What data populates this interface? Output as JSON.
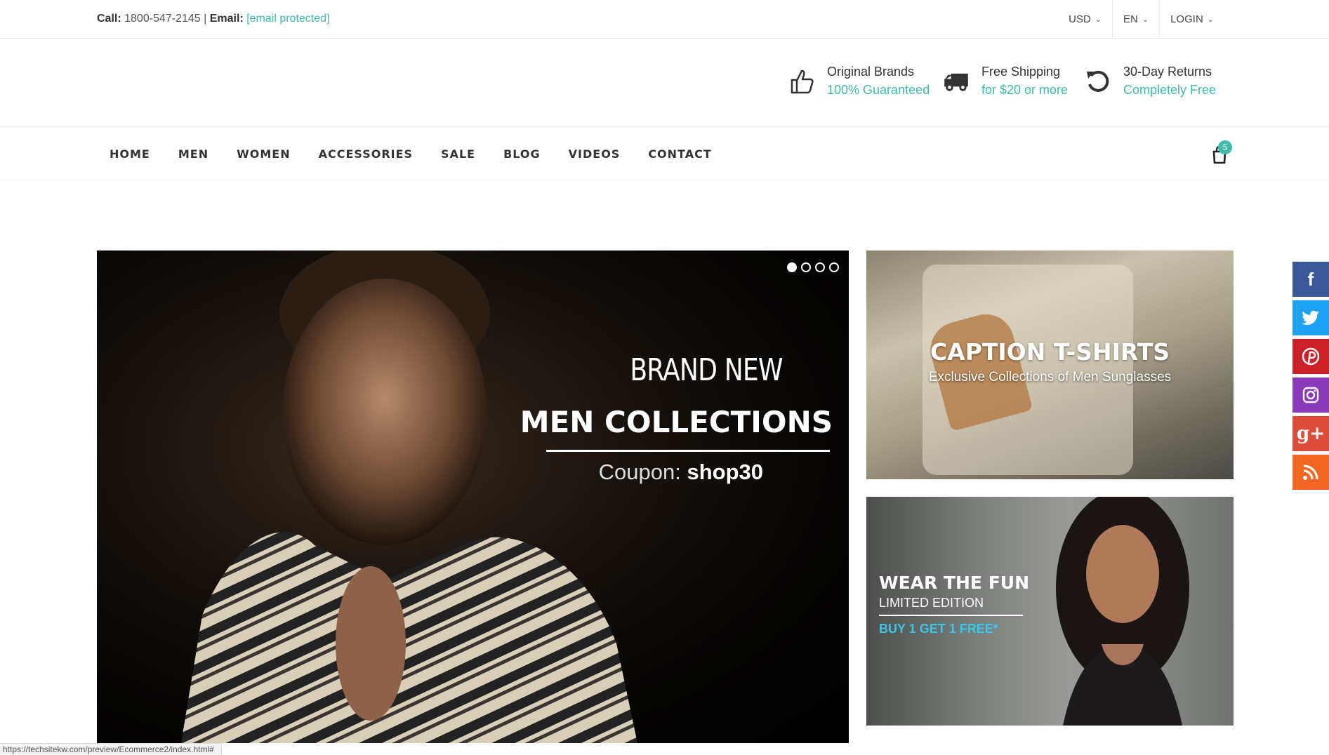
{
  "topbar": {
    "call_label": "Call:",
    "phone": "1800-547-2145",
    "separator": "|",
    "email_label": "Email:",
    "email": "[email protected]",
    "currency": "USD",
    "language": "EN",
    "login": "LOGIN"
  },
  "promos": [
    {
      "icon": "thumbs-up-icon",
      "title": "Original Brands",
      "subtitle": "100% Guaranteed"
    },
    {
      "icon": "truck-icon",
      "title": "Free Shipping",
      "subtitle": "for $20 or more"
    },
    {
      "icon": "refresh-icon",
      "title": "30-Day Returns",
      "subtitle": "Completely Free"
    }
  ],
  "nav": {
    "items": [
      "HOME",
      "MEN",
      "WOMEN",
      "ACCESSORIES",
      "SALE",
      "BLOG",
      "VIDEOS",
      "CONTACT"
    ],
    "cart_count": "5"
  },
  "hero": {
    "line1": "BRAND NEW",
    "line2": "MEN COLLECTIONS",
    "coupon_label": "Coupon:",
    "coupon_code": "shop30",
    "active_slide": 1,
    "slide_count": 4
  },
  "banners": {
    "tshirts": {
      "title": "CAPTION T-SHIRTS",
      "subtitle": "Exclusive Collections of Men Sunglasses"
    },
    "fun": {
      "title": "WEAR THE FUN",
      "edition": "LIMITED EDITION",
      "offer": "BUY 1 GET 1 FREE*"
    }
  },
  "social": [
    {
      "name": "facebook",
      "glyph": "f",
      "color": "#3b5998"
    },
    {
      "name": "twitter",
      "glyph": "t",
      "color": "#1da1f2"
    },
    {
      "name": "pinterest",
      "glyph": "P",
      "color": "#cb2027"
    },
    {
      "name": "instagram",
      "glyph": "◎",
      "color": "#8a3ab9"
    },
    {
      "name": "google-plus",
      "glyph": "g+",
      "color": "#dd4b39"
    },
    {
      "name": "rss",
      "glyph": "≋",
      "color": "#f26522"
    }
  ],
  "status_url": "https://techsitekw.com/preview/Ecommerce2/index.html#",
  "colors": {
    "accent": "#3fbba8"
  }
}
